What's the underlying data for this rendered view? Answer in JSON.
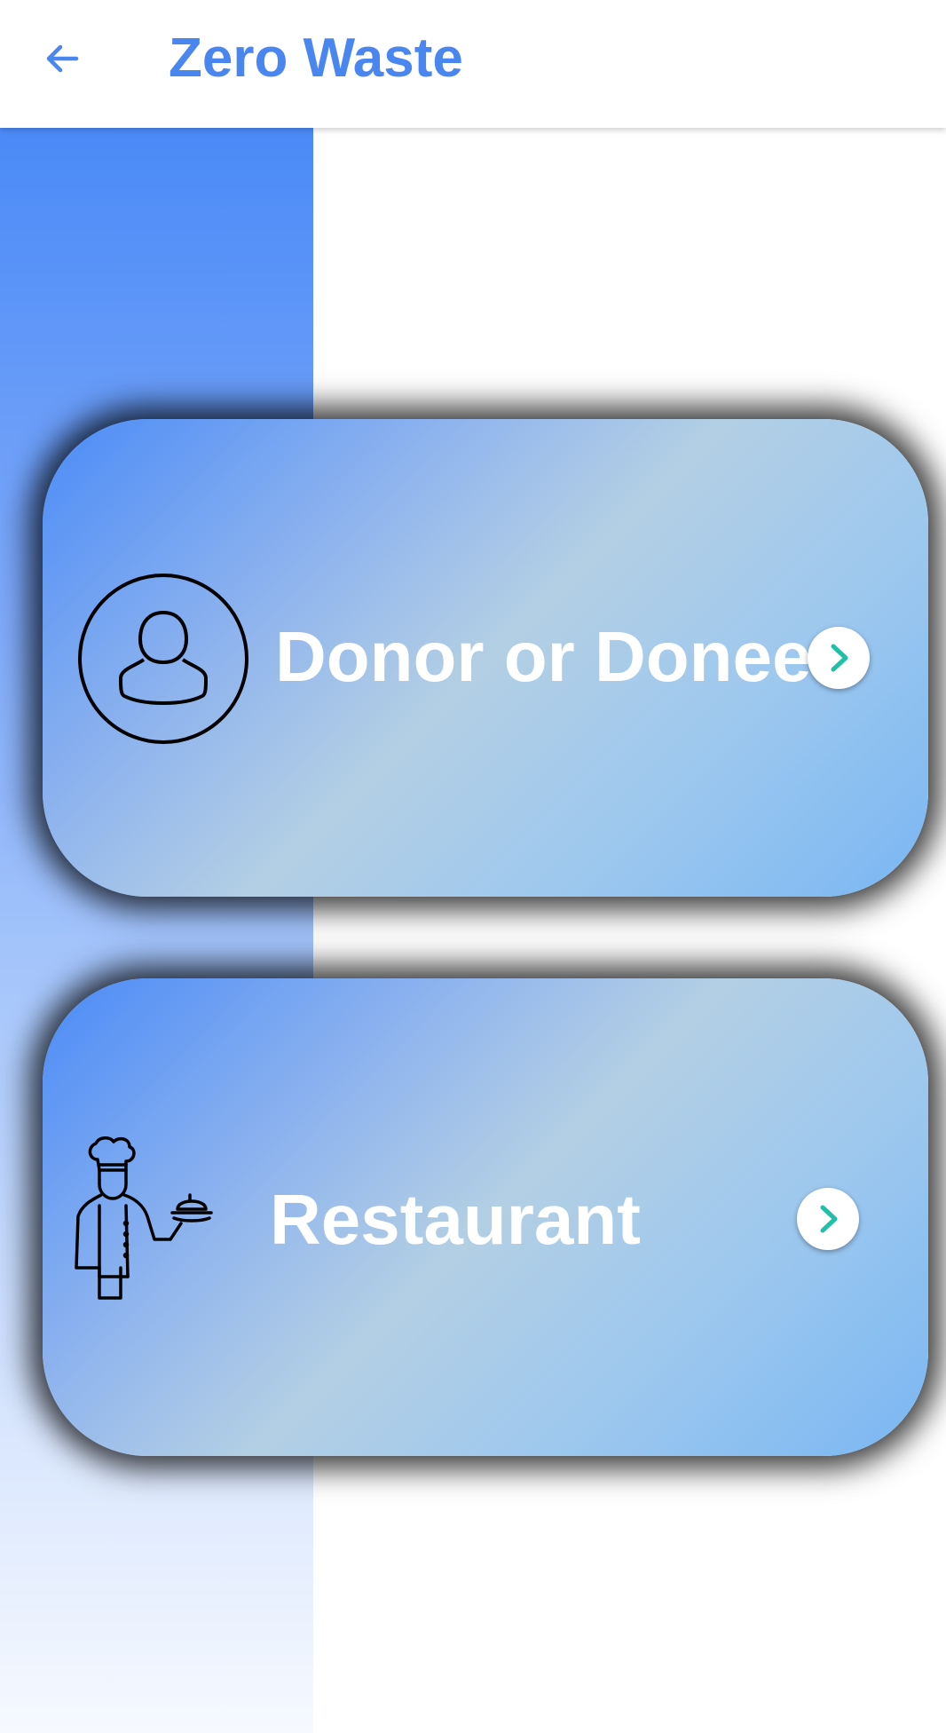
{
  "app_bar": {
    "title": "Zero Waste",
    "back_icon": "arrow-left-icon",
    "color": "#4a86f0"
  },
  "cards": [
    {
      "label": "Donor or Donee",
      "icon": "user-circle-icon",
      "action_icon": "chevron-right-icon"
    },
    {
      "label": "Restaurant",
      "icon": "chef-icon",
      "action_icon": "chevron-right-icon"
    }
  ],
  "colors": {
    "accent": "#4a86f0",
    "chevron": "#1fbfa8",
    "card_gradient_start": "#4b8bf7",
    "card_gradient_mid": "#b3cfe4",
    "card_gradient_end": "#7ab7f3"
  }
}
